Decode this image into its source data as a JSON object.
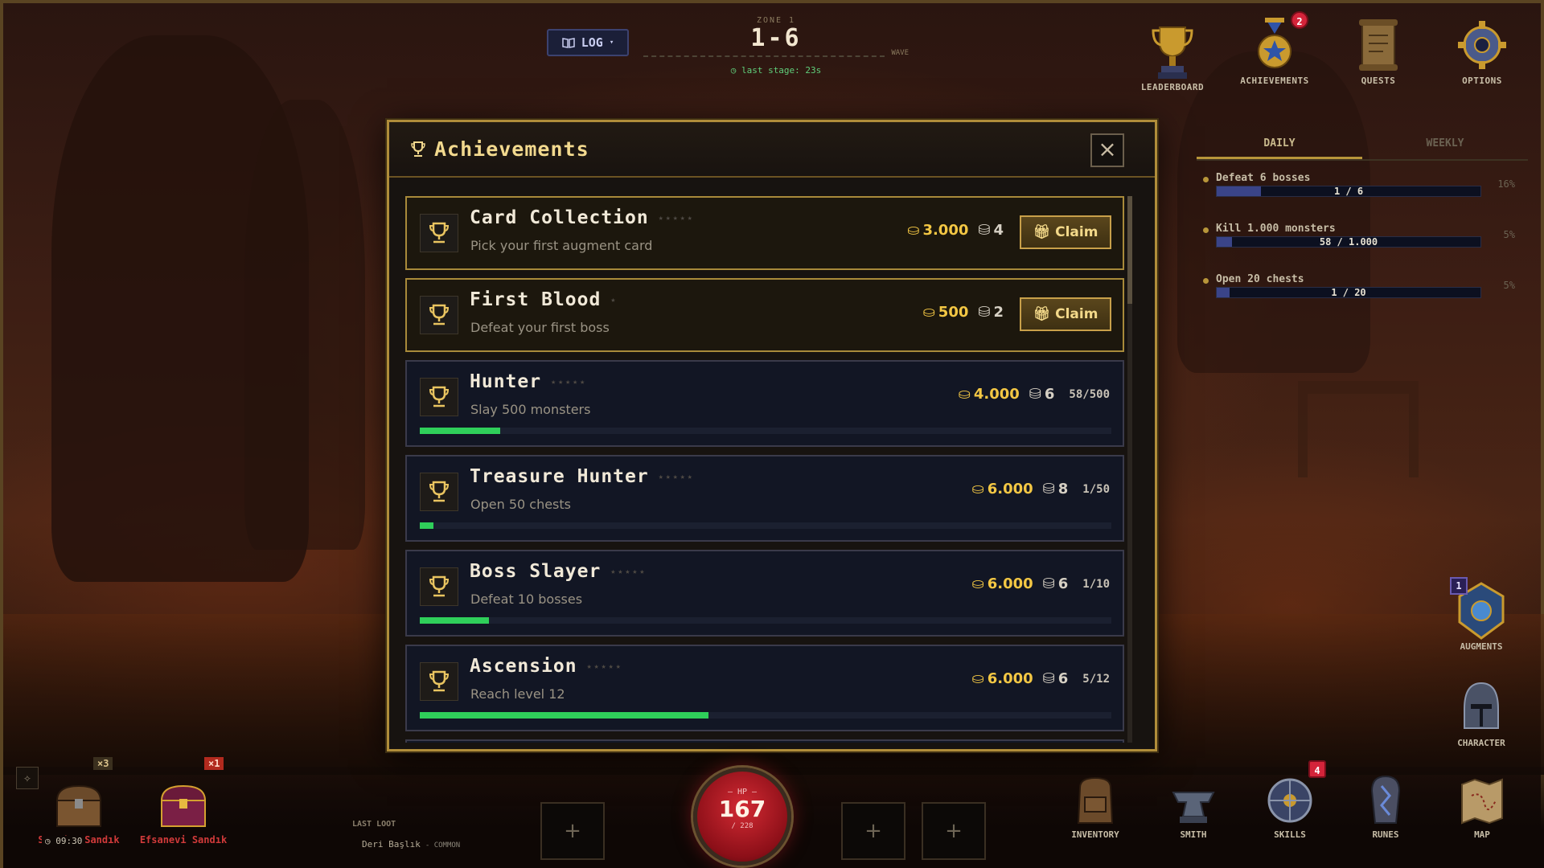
{
  "hud": {
    "log_label": "LOG",
    "zone_label": "ZONE 1",
    "stage": "1-6",
    "wave_label": "WAVE",
    "last_stage": "last stage: 23s"
  },
  "top_menu": [
    {
      "label": "LEADERBOARD",
      "icon": "trophy-icon"
    },
    {
      "label": "ACHIEVEMENTS",
      "icon": "medal-icon",
      "badge": "2"
    },
    {
      "label": "QUESTS",
      "icon": "scroll-icon"
    },
    {
      "label": "OPTIONS",
      "icon": "gear-icon"
    }
  ],
  "quests": {
    "tabs": [
      "DAILY",
      "WEEKLY"
    ],
    "active_tab": "DAILY",
    "items": [
      {
        "name": "Defeat 6 bosses",
        "progress": "1 / 6",
        "pct": "16%",
        "fraction": 0.167
      },
      {
        "name": "Kill 1.000 monsters",
        "progress": "58 / 1.000",
        "pct": "5%",
        "fraction": 0.058
      },
      {
        "name": "Open 20 chests",
        "progress": "1 / 20",
        "pct": "5%",
        "fraction": 0.05
      }
    ]
  },
  "modal": {
    "title": "Achievements",
    "claim_label": "Claim",
    "achievements": [
      {
        "name": "Card Collection",
        "stars": "★★★★★",
        "desc": "Pick your first augment card",
        "gold": "3.000",
        "gems": "4",
        "status": "claimable"
      },
      {
        "name": "First Blood",
        "stars": "★",
        "desc": "Defeat your first boss",
        "gold": "500",
        "gems": "2",
        "status": "claimable"
      },
      {
        "name": "Hunter",
        "stars": "★★★★★",
        "desc": "Slay 500 monsters",
        "gold": "4.000",
        "gems": "6",
        "progress": "58/500",
        "fraction": 0.116,
        "status": "progress"
      },
      {
        "name": "Treasure Hunter",
        "stars": "★★★★★",
        "desc": "Open 50 chests",
        "gold": "6.000",
        "gems": "8",
        "progress": "1/50",
        "fraction": 0.02,
        "status": "progress"
      },
      {
        "name": "Boss Slayer",
        "stars": "★★★★★",
        "desc": "Defeat 10 bosses",
        "gold": "6.000",
        "gems": "6",
        "progress": "1/10",
        "fraction": 0.1,
        "status": "progress"
      },
      {
        "name": "Ascension",
        "stars": "★★★★★",
        "desc": "Reach level 12",
        "gold": "6.000",
        "gems": "6",
        "progress": "5/12",
        "fraction": 0.417,
        "status": "progress"
      }
    ]
  },
  "chests": [
    {
      "label": "Sıradan Sandık",
      "mult": "×3",
      "timer": "09:30"
    },
    {
      "label": "Efsanevi Sandık",
      "mult": "×1"
    }
  ],
  "last_loot": {
    "label": "LAST LOOT",
    "item": "Deri Başlık",
    "rarity": "- COMMON"
  },
  "hp": {
    "label": "— HP —",
    "value": "167",
    "max": "/ 228",
    "fraction": 0.732
  },
  "slot_plus": "+",
  "side_menu": [
    {
      "label": "AUGMENTS",
      "icon": "augment-icon",
      "badge": "1"
    },
    {
      "label": "CHARACTER",
      "icon": "helmet-icon"
    }
  ],
  "dock": [
    {
      "label": "INVENTORY",
      "icon": "backpack-icon"
    },
    {
      "label": "SMITH",
      "icon": "anvil-icon"
    },
    {
      "label": "SKILLS",
      "icon": "skill-wheel-icon",
      "badge": "4"
    },
    {
      "label": "RUNES",
      "icon": "rune-stone-icon"
    },
    {
      "label": "MAP",
      "icon": "map-icon"
    }
  ],
  "colors": {
    "accent_gold": "#b08d3a",
    "progress_green": "#2fcf5a",
    "badge_red": "#d4243a",
    "hp_red": "#d22a33"
  }
}
